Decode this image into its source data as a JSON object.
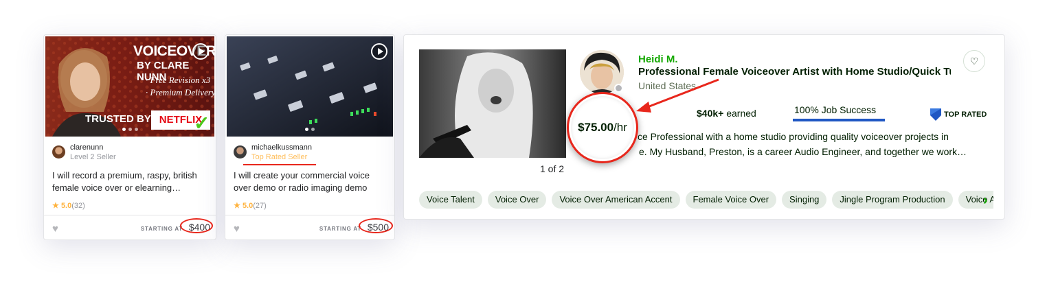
{
  "gigs": [
    {
      "thumb_text": {
        "line1": "VOICEOVERS",
        "line2": "BY CLARE NUNN",
        "line3": "· Free Revision x3",
        "line4": "· Premium Delivery",
        "trusted": "TRUSTED BY:",
        "brand": "NETFLIX"
      },
      "seller_name": "clarenunn",
      "seller_level": "Level 2 Seller",
      "title": "I will record a premium, raspy, british female voice over or elearning…",
      "rating": "5.0",
      "rating_count": "(32)",
      "starting_at": "STARTING AT",
      "price": "$400"
    },
    {
      "seller_name": "michaelkussmann",
      "seller_level": "Top Rated Seller",
      "title": "I will create your commercial voice over demo or radio imaging demo",
      "rating": "5.0",
      "rating_count": "(27)",
      "starting_at": "STARTING AT",
      "price": "$500"
    }
  ],
  "profile": {
    "photo_counter": "1 of 2",
    "name": "Heidi M.",
    "title": "Professional Female Voiceover Artist with Home Studio/Quick Tur…",
    "country": "United States",
    "rate": "$75.00",
    "rate_unit": "/hr",
    "earned_amount": "$40k+",
    "earned_label": "earned",
    "job_success": "100% Job Success",
    "badge": "TOP RATED",
    "desc_line1": "ce Professional with a home studio providing quality voiceover projects in",
    "desc_line2": "e. My Husband, Preston, is a career Audio Engineer, and together we work…",
    "skills": [
      "Voice Talent",
      "Voice Over",
      "Voice Over American Accent",
      "Female Voice Over",
      "Singing",
      "Jingle Program Production",
      "Voice Acting"
    ]
  },
  "colors": {
    "accent_green": "#14a800",
    "annotation_red": "#e8271c",
    "job_success_blue": "#1f57c3",
    "top_rated_seller": "#ffbe5b"
  }
}
